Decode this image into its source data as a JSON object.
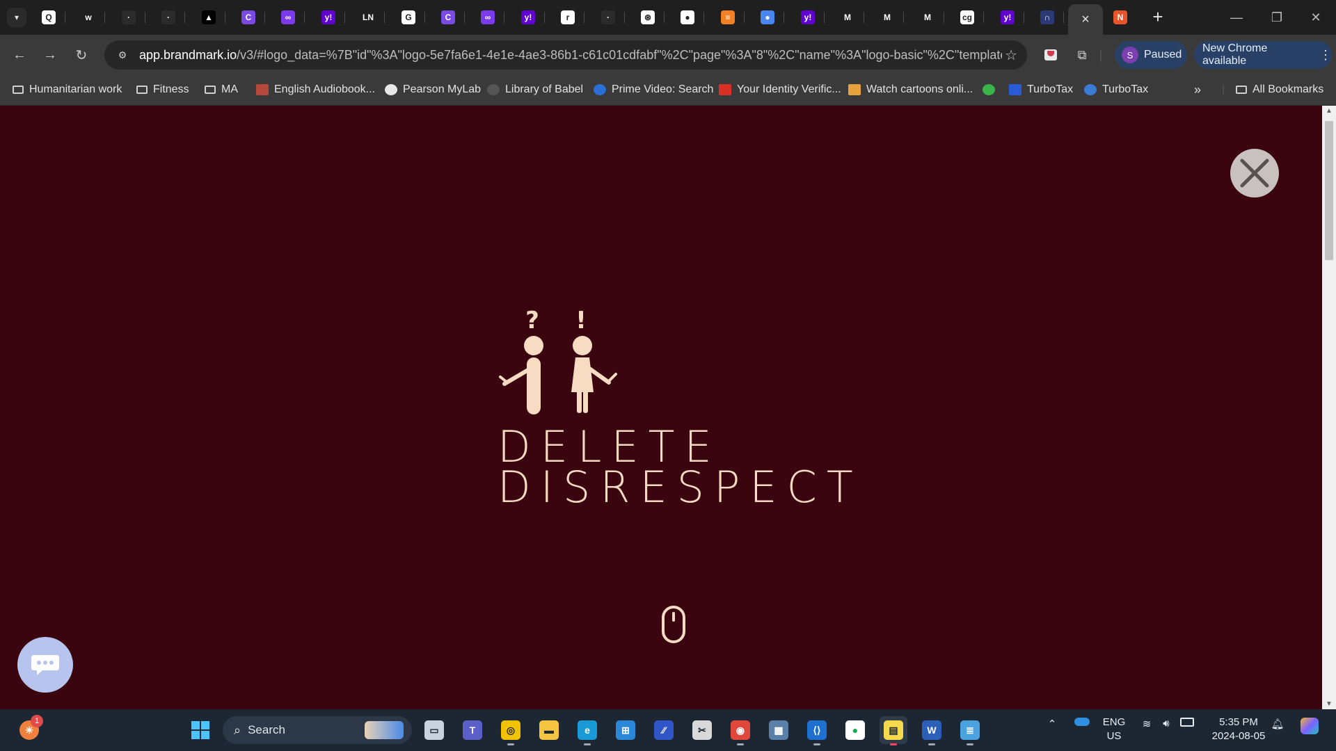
{
  "browser": {
    "tabs": [
      {
        "icon": "qr-icon",
        "color": "#ffffff",
        "glyph": "Q"
      },
      {
        "icon": "wiz-icon",
        "color": "#1f1f1f",
        "glyph": "w"
      },
      {
        "icon": "dark-app-icon",
        "color": "#2b2b2b",
        "glyph": "·"
      },
      {
        "icon": "dark-app-icon-2",
        "color": "#2b2b2b",
        "glyph": "·"
      },
      {
        "icon": "vercel-icon",
        "color": "#000000",
        "glyph": "▲"
      },
      {
        "icon": "canvas-icon",
        "color": "#7b4ae2",
        "glyph": "C"
      },
      {
        "icon": "chat-icon",
        "color": "#7c3aed",
        "glyph": "∞"
      },
      {
        "icon": "yahoo-icon",
        "color": "#6001d2",
        "glyph": "y!"
      },
      {
        "icon": "ln-icon",
        "color": "#1f1f1f",
        "glyph": "LN"
      },
      {
        "icon": "google-icon",
        "color": "#ffffff",
        "glyph": "G"
      },
      {
        "icon": "canvas-icon",
        "color": "#7b4ae2",
        "glyph": "C"
      },
      {
        "icon": "chat-icon",
        "color": "#7c3aed",
        "glyph": "∞"
      },
      {
        "icon": "yahoo-icon",
        "color": "#6001d2",
        "glyph": "y!"
      },
      {
        "icon": "r-icon",
        "color": "#ffffff",
        "glyph": "r"
      },
      {
        "icon": "dark-app-icon-3",
        "color": "#2b2b2b",
        "glyph": "·"
      },
      {
        "icon": "openai-icon",
        "color": "#ffffff",
        "glyph": "⊛"
      },
      {
        "icon": "github-icon",
        "color": "#ffffff",
        "glyph": "●"
      },
      {
        "icon": "stackoverflow-icon",
        "color": "#f48024",
        "glyph": "≡"
      },
      {
        "icon": "circle-app-icon",
        "color": "#4a86f0",
        "glyph": "●"
      },
      {
        "icon": "yahoo-icon",
        "color": "#6001d2",
        "glyph": "y!"
      },
      {
        "icon": "m-green-icon",
        "color": "#1f1f1f",
        "glyph": "M"
      },
      {
        "icon": "gmail-m-icon",
        "color": "#1f1f1f",
        "glyph": "M"
      },
      {
        "icon": "mu-icon",
        "color": "#1f1f1f",
        "glyph": "M"
      },
      {
        "icon": "cg-icon",
        "color": "#ffffff",
        "glyph": "cg"
      },
      {
        "icon": "yahoo-icon",
        "color": "#6001d2",
        "glyph": "y!"
      },
      {
        "icon": "n-icon",
        "color": "#2b3a77",
        "glyph": "∩"
      }
    ],
    "last_tab": {
      "icon": "brandmark-icon",
      "color": "#e8542c",
      "glyph": "N"
    },
    "address": {
      "host": "app.brandmark.io",
      "path": "/v3/#logo_data=%7B\"id\"%3A\"logo-5e7fa6e1-4e1e-4ae3-86b1-c61c01cdfabf\"%2C\"page\"%3A\"8\"%2C\"name\"%3A\"logo-basic\"%2C\"template\"..."
    },
    "profile": {
      "initial": "S",
      "label": "Paused"
    },
    "update_label": "New Chrome available",
    "bookmarks": [
      {
        "label": "Humanitarian work",
        "icon": "folder-icon"
      },
      {
        "label": "Fitness",
        "icon": "folder-icon"
      },
      {
        "label": "MA",
        "icon": "folder-icon"
      },
      {
        "label": "English Audiobook...",
        "icon": "audiobook-icon"
      },
      {
        "label": "Pearson MyLab",
        "icon": "pearson-icon"
      },
      {
        "label": "Library of Babel",
        "icon": "babel-icon"
      },
      {
        "label": "Prime Video: Search",
        "icon": "prime-icon"
      },
      {
        "label": "Your Identity Verific...",
        "icon": "gmail-icon"
      },
      {
        "label": "Watch cartoons onli...",
        "icon": "cartoon-icon"
      },
      {
        "label": "",
        "icon": "green-bolt-icon"
      },
      {
        "label": "TurboTax",
        "icon": "intuit-icon"
      },
      {
        "label": "TurboTax",
        "icon": "turbotax-icon"
      }
    ],
    "all_bookmarks": "All Bookmarks"
  },
  "page": {
    "logo_line1": "DELETE",
    "logo_line2": "DISRESPECT",
    "question_mark": "?",
    "exclamation": "!",
    "colors": {
      "background": "#3a050f",
      "logo": "#f7dbc3"
    }
  },
  "taskbar": {
    "search_label": "Search",
    "notification_count": "1",
    "lang_line1": "ENG",
    "lang_line2": "US",
    "time": "5:35 PM",
    "date": "2024-08-05"
  }
}
